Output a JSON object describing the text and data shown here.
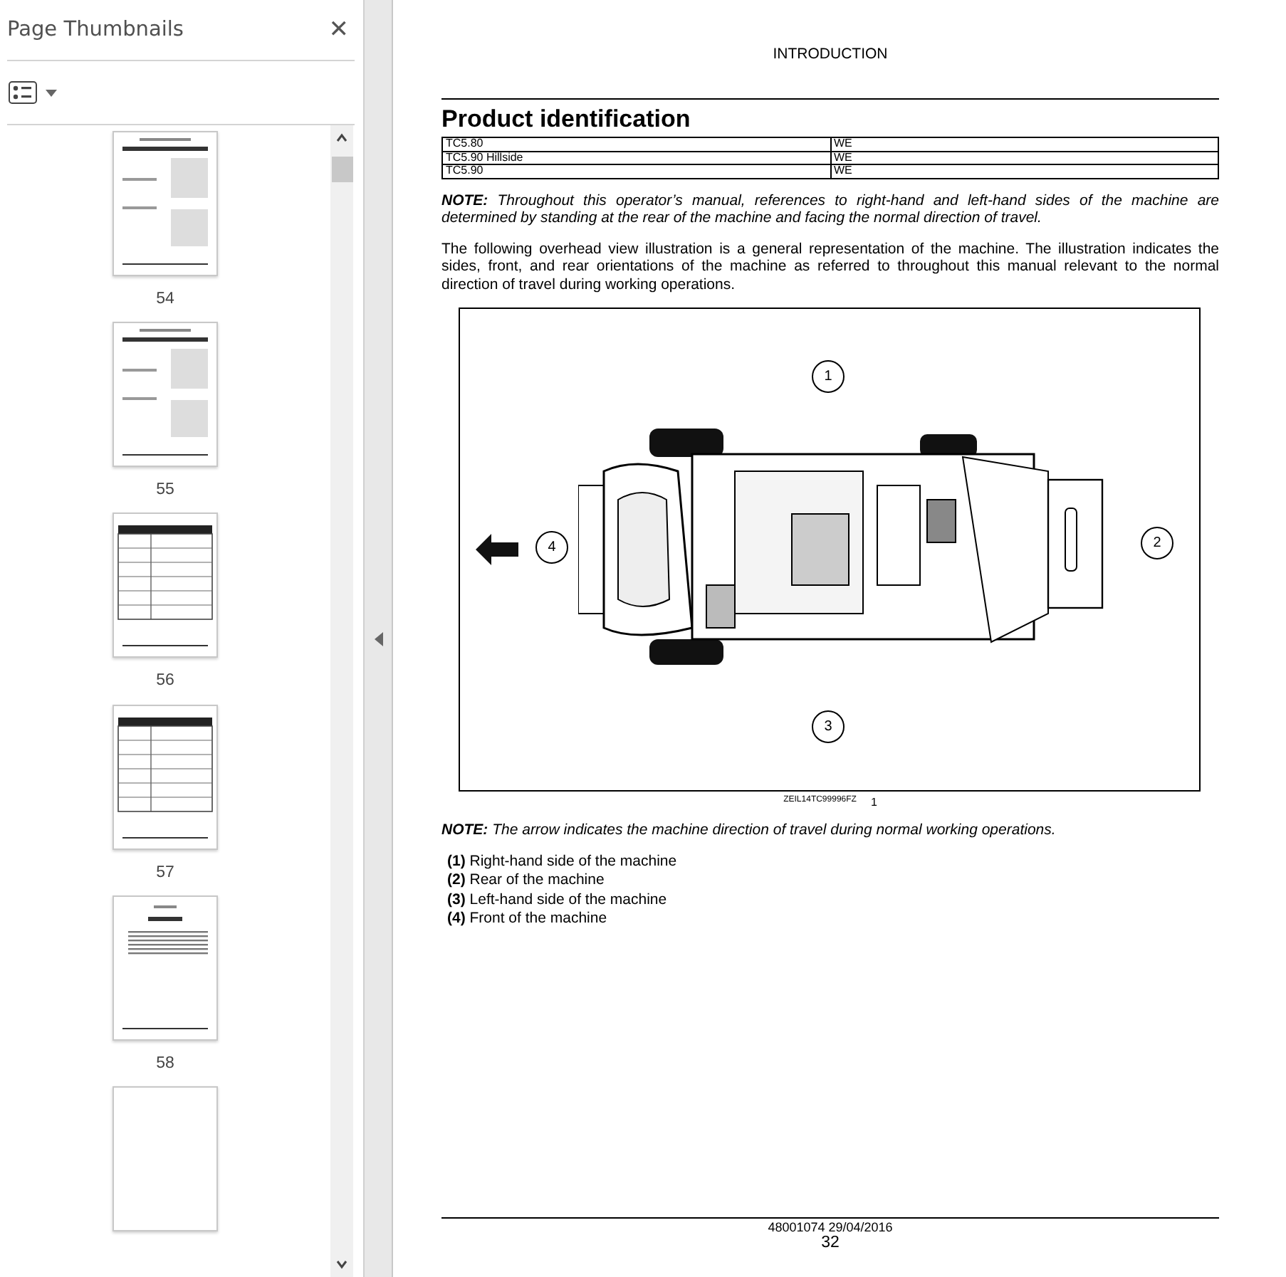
{
  "sidebar": {
    "title": "Page Thumbnails",
    "close_label": "✕",
    "thumbnails": [
      {
        "label": "54",
        "kind": "figure"
      },
      {
        "label": "55",
        "kind": "figure"
      },
      {
        "label": "56",
        "kind": "table"
      },
      {
        "label": "57",
        "kind": "table"
      },
      {
        "label": "58",
        "kind": "toc"
      },
      {
        "kind": "blank"
      }
    ]
  },
  "page": {
    "header": "INTRODUCTION",
    "title": "Product identification",
    "table": [
      [
        "TC5.80",
        "WE"
      ],
      [
        "TC5.90 Hillside",
        "WE"
      ],
      [
        "TC5.90",
        "WE"
      ]
    ],
    "note": "**NOTE:** Throughout this operator’s manual, references to right-hand and left-hand sides of the machine are determined by standing at the rear of the machine and facing the normal direction of travel.",
    "paragraph": "The following overhead view illustration is a general representation of the machine. The illustration indicates the sides, front, and rear orientations of the machine as referred to throughout this manual relevant to the normal direction of travel during working operations.",
    "figure": {
      "callouts": [
        {
          "number": "1",
          "kind": "top"
        },
        {
          "number": "2",
          "kind": "right"
        },
        {
          "number": "3",
          "kind": "bottom"
        },
        {
          "number": "4",
          "kind": "left"
        }
      ],
      "code": "ZEIL14TC99996FZ",
      "number": "1"
    },
    "note2": "**NOTE:** The arrow indicates the machine direction of travel during normal working operations.",
    "legend": [
      "**(1)** Right-hand side of the machine",
      "**(2)** Rear of the machine",
      "**(3)** Left-hand side of the machine",
      "**(4)** Front of the machine"
    ],
    "footer": {
      "doc": "48001074 29/04/2016",
      "page": "32"
    }
  }
}
